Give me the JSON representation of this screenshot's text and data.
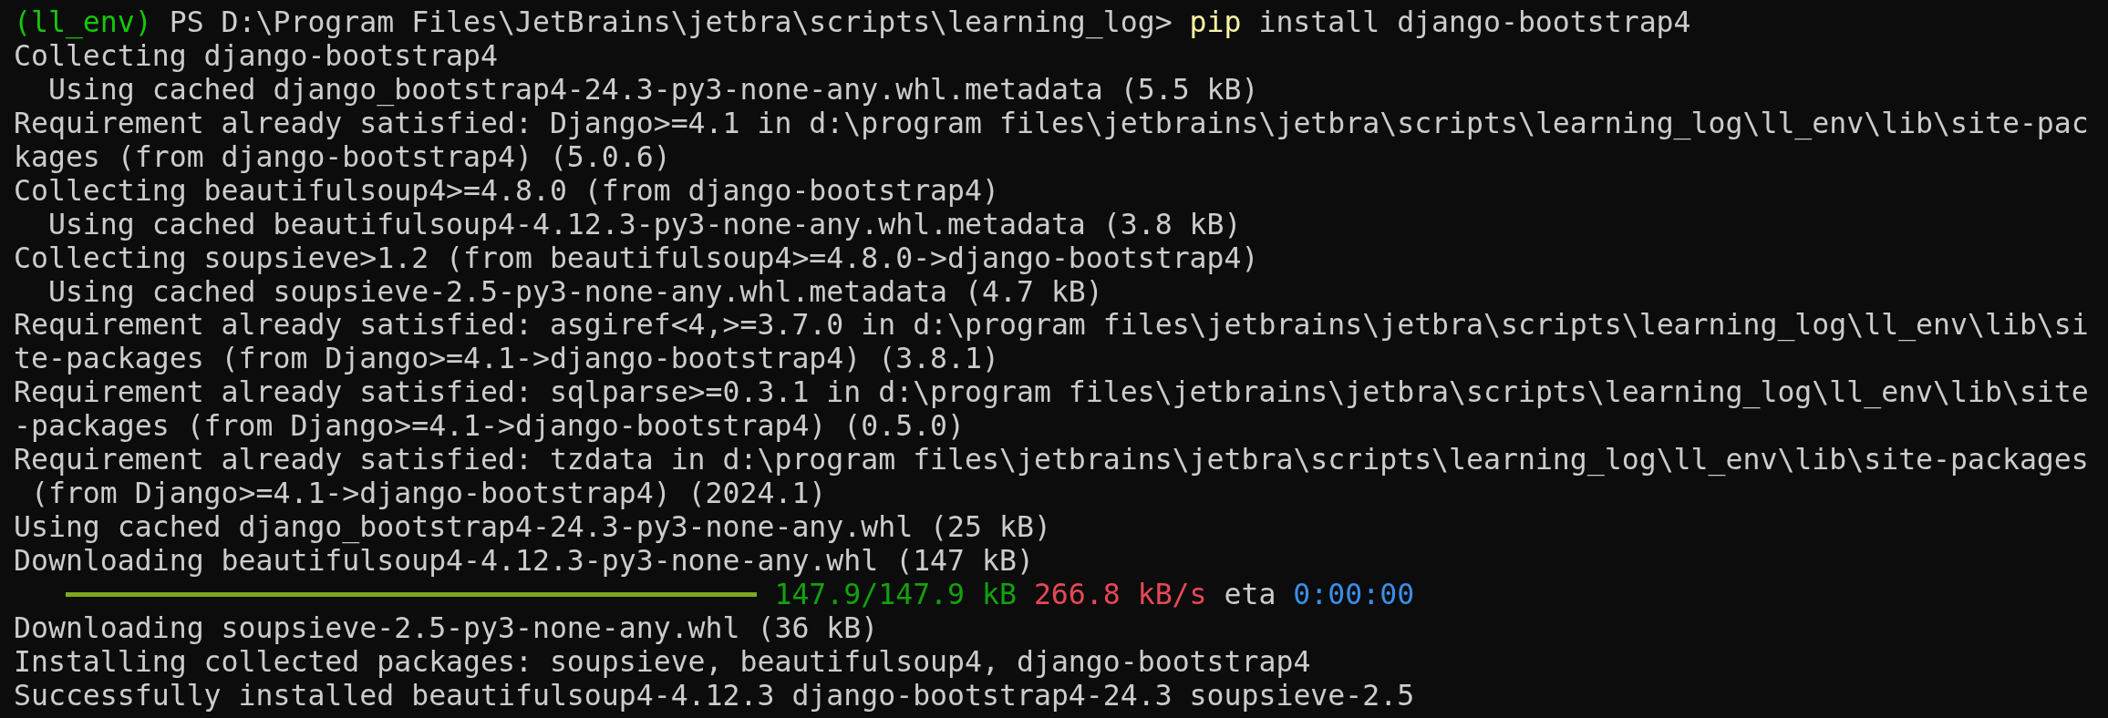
{
  "terminal": {
    "lines": [
      {
        "kind": "prompt",
        "env": "(ll_env)",
        "path": "PS D:\\Program Files\\JetBrains\\jetbra\\scripts\\learning_log>",
        "command": "pip",
        "args": "install django-bootstrap4"
      },
      {
        "kind": "output",
        "text": "Collecting django-bootstrap4"
      },
      {
        "kind": "output",
        "text": "  Using cached django_bootstrap4-24.3-py3-none-any.whl.metadata (5.5 kB)"
      },
      {
        "kind": "output",
        "text": "Requirement already satisfied: Django>=4.1 in d:\\program files\\jetbrains\\jetbra\\scripts\\learning_log\\ll_env\\lib\\site-pac"
      },
      {
        "kind": "output",
        "text": "kages (from django-bootstrap4) (5.0.6)"
      },
      {
        "kind": "output",
        "text": "Collecting beautifulsoup4>=4.8.0 (from django-bootstrap4)"
      },
      {
        "kind": "output",
        "text": "  Using cached beautifulsoup4-4.12.3-py3-none-any.whl.metadata (3.8 kB)"
      },
      {
        "kind": "output",
        "text": "Collecting soupsieve>1.2 (from beautifulsoup4>=4.8.0->django-bootstrap4)"
      },
      {
        "kind": "output",
        "text": "  Using cached soupsieve-2.5-py3-none-any.whl.metadata (4.7 kB)"
      },
      {
        "kind": "output",
        "text": "Requirement already satisfied: asgiref<4,>=3.7.0 in d:\\program files\\jetbrains\\jetbra\\scripts\\learning_log\\ll_env\\lib\\si"
      },
      {
        "kind": "output",
        "text": "te-packages (from Django>=4.1->django-bootstrap4) (3.8.1)"
      },
      {
        "kind": "output",
        "text": "Requirement already satisfied: sqlparse>=0.3.1 in d:\\program files\\jetbrains\\jetbra\\scripts\\learning_log\\ll_env\\lib\\site"
      },
      {
        "kind": "output",
        "text": "-packages (from Django>=4.1->django-bootstrap4) (0.5.0)"
      },
      {
        "kind": "output",
        "text": "Requirement already satisfied: tzdata in d:\\program files\\jetbrains\\jetbra\\scripts\\learning_log\\ll_env\\lib\\site-packages"
      },
      {
        "kind": "output",
        "text": " (from Django>=4.1->django-bootstrap4) (2024.1)"
      },
      {
        "kind": "output",
        "text": "Using cached django_bootstrap4-24.3-py3-none-any.whl (25 kB)"
      },
      {
        "kind": "output",
        "text": "Downloading beautifulsoup4-4.12.3-py3-none-any.whl (147 kB)"
      },
      {
        "kind": "progress",
        "level": 1,
        "done": "147.9/147.9 kB",
        "speed": "266.8 kB/s",
        "eta_label": "eta",
        "eta": "0:00:00"
      },
      {
        "kind": "output",
        "text": "Downloading soupsieve-2.5-py3-none-any.whl (36 kB)"
      },
      {
        "kind": "output",
        "text": "Installing collected packages: soupsieve, beautifulsoup4, django-bootstrap4"
      },
      {
        "kind": "output",
        "text": "Successfully installed beautifulsoup4-4.12.3 django-bootstrap4-24.3 soupsieve-2.5"
      }
    ]
  }
}
